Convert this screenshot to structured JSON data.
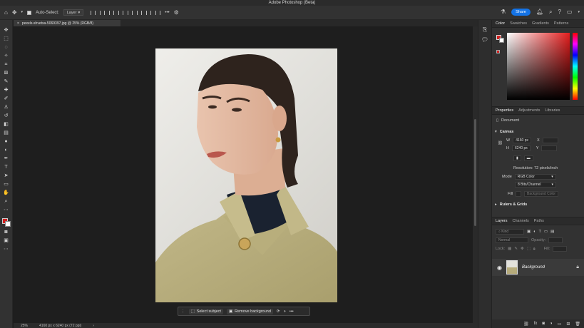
{
  "app": {
    "title": "Adobe Photoshop (Beta)"
  },
  "options_bar": {
    "auto_select_label": "Auto-Select:",
    "auto_select_value": "Layer",
    "more_label": "•••",
    "share_label": "Share"
  },
  "document": {
    "tab_label": "pexels-shvetsa-5069397.jpg @ 25% (RGB/8)",
    "zoom": "25%",
    "info": "4160 px x 6240 px (72 ppi)"
  },
  "context_bar": {
    "select_subject": "Select subject",
    "remove_background": "Remove background",
    "more": "•••"
  },
  "color_panel": {
    "tabs": [
      "Color",
      "Swatches",
      "Gradients",
      "Patterns"
    ],
    "foreground": "#d0201f",
    "background": "#ffffff"
  },
  "properties_panel": {
    "tabs": [
      "Properties",
      "Adjustments",
      "Libraries"
    ],
    "type_label": "Document",
    "canvas_title": "Canvas",
    "width_label": "W",
    "width_value": "4160 px",
    "height_label": "H",
    "height_value": "6240 px",
    "x_label": "X",
    "y_label": "Y",
    "resolution": "Resolution: 72 pixels/inch",
    "mode_label": "Mode",
    "mode_value": "RGB Color",
    "depth_value": "8 Bits/Channel",
    "fill_label": "Fill",
    "fill_value": "Background Color",
    "rulers_title": "Rulers & Grids"
  },
  "layers_panel": {
    "tabs": [
      "Layers",
      "Channels",
      "Paths"
    ],
    "filter_placeholder": "Kind",
    "blend_mode": "Normal",
    "opacity_label": "Opacity:",
    "lock_label": "Lock:",
    "fill_label": "Fill:",
    "layer_name": "Background"
  }
}
